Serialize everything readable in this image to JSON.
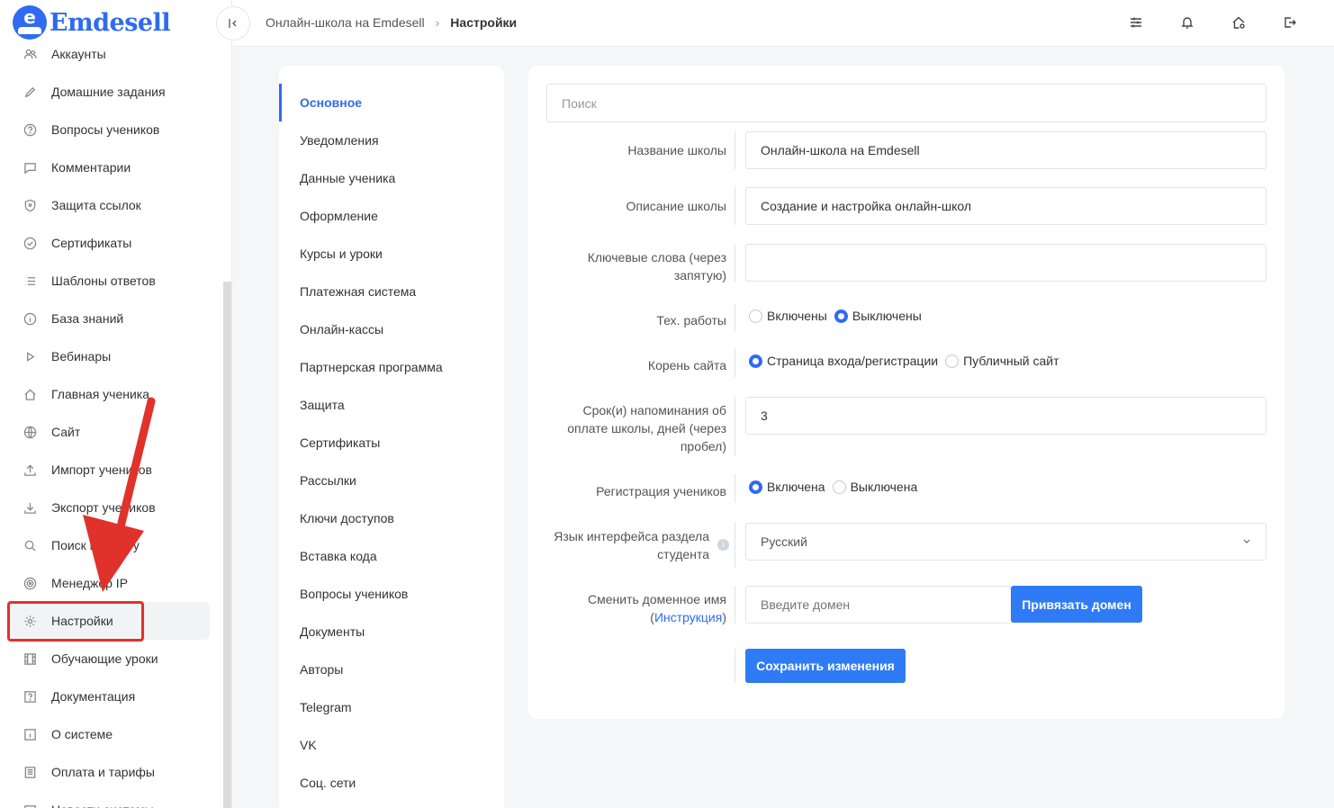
{
  "brand": {
    "name": "Emdesell",
    "logo_letter": "e",
    "accent": "#2f6bf0"
  },
  "sidebar": {
    "items": [
      {
        "label": "Аккаунты",
        "icon": "users-icon"
      },
      {
        "label": "Домашние задания",
        "icon": "pencil-icon"
      },
      {
        "label": "Вопросы учеников",
        "icon": "question-circle-icon"
      },
      {
        "label": "Комментарии",
        "icon": "comment-icon"
      },
      {
        "label": "Защита ссылок",
        "icon": "shield-icon"
      },
      {
        "label": "Сертификаты",
        "icon": "check-circle-icon"
      },
      {
        "label": "Шаблоны ответов",
        "icon": "list-icon"
      },
      {
        "label": "База знаний",
        "icon": "info-circle-icon"
      },
      {
        "label": "Вебинары",
        "icon": "play-icon"
      },
      {
        "label": "Главная ученика",
        "icon": "home-icon"
      },
      {
        "label": "Сайт",
        "icon": "globe-icon"
      },
      {
        "label": "Импорт учеников",
        "icon": "upload-icon"
      },
      {
        "label": "Экспорт учеников",
        "icon": "download-icon"
      },
      {
        "label": "Поиск по почту",
        "icon": "search-icon"
      },
      {
        "label": "Менеджер IP",
        "icon": "target-icon"
      },
      {
        "label": "Настройки",
        "icon": "gear-icon",
        "active": true
      },
      {
        "label": "Обучающие уроки",
        "icon": "film-icon"
      },
      {
        "label": "Документация",
        "icon": "help-box-icon"
      },
      {
        "label": "О системе",
        "icon": "info-box-icon"
      },
      {
        "label": "Оплата и тарифы",
        "icon": "invoice-icon"
      },
      {
        "label": "Новости системы",
        "icon": "news-icon"
      }
    ]
  },
  "topbar": {
    "collapse_icon": "collapse-icon",
    "breadcrumb": [
      "Онлайн-школа на Emdesell",
      "Настройки"
    ],
    "separator": "›",
    "icons": [
      "sliders-icon",
      "bell-icon",
      "home-settings-icon",
      "logout-icon"
    ]
  },
  "settings_menu": {
    "items": [
      "Основное",
      "Уведомления",
      "Данные ученика",
      "Оформление",
      "Курсы и уроки",
      "Платежная система",
      "Онлайн-кассы",
      "Партнерская программа",
      "Защита",
      "Сертификаты",
      "Рассылки",
      "Ключи доступов",
      "Вставка кода",
      "Вопросы учеников",
      "Документы",
      "Авторы",
      "Telegram",
      "VK",
      "Соц. сети"
    ],
    "active_index": 0
  },
  "form": {
    "search_placeholder": "Поиск",
    "school_name": {
      "label": "Название школы",
      "value": "Онлайн-школа на Emdesell"
    },
    "school_description": {
      "label": "Описание школы",
      "value": "Создание и настройка онлайн-школ"
    },
    "keywords": {
      "label": "Ключевые слова (через запятую)",
      "value": ""
    },
    "maintenance": {
      "label": "Тех. работы",
      "options": [
        "Включены",
        "Выключены"
      ],
      "selected": 1
    },
    "site_root": {
      "label": "Корень сайта",
      "options": [
        "Страница входа/регистрации",
        "Публичный сайт"
      ],
      "selected": 0
    },
    "payment_reminder": {
      "label": "Срок(и) напоминания об оплате школы, дней (через пробел)",
      "value": "3"
    },
    "registration": {
      "label": "Регистрация учеников",
      "options": [
        "Включена",
        "Выключена"
      ],
      "selected": 0
    },
    "language": {
      "label": "Язык интерфейса раздела студента",
      "value": "Русский",
      "info_icon": "info-icon"
    },
    "domain": {
      "label": "Сменить доменное имя",
      "link": "Инструкция",
      "placeholder": "Введите домен",
      "button": "Привязать домен"
    },
    "save_button": "Сохранить изменения"
  },
  "annotation": {
    "color": "#e0322b"
  }
}
